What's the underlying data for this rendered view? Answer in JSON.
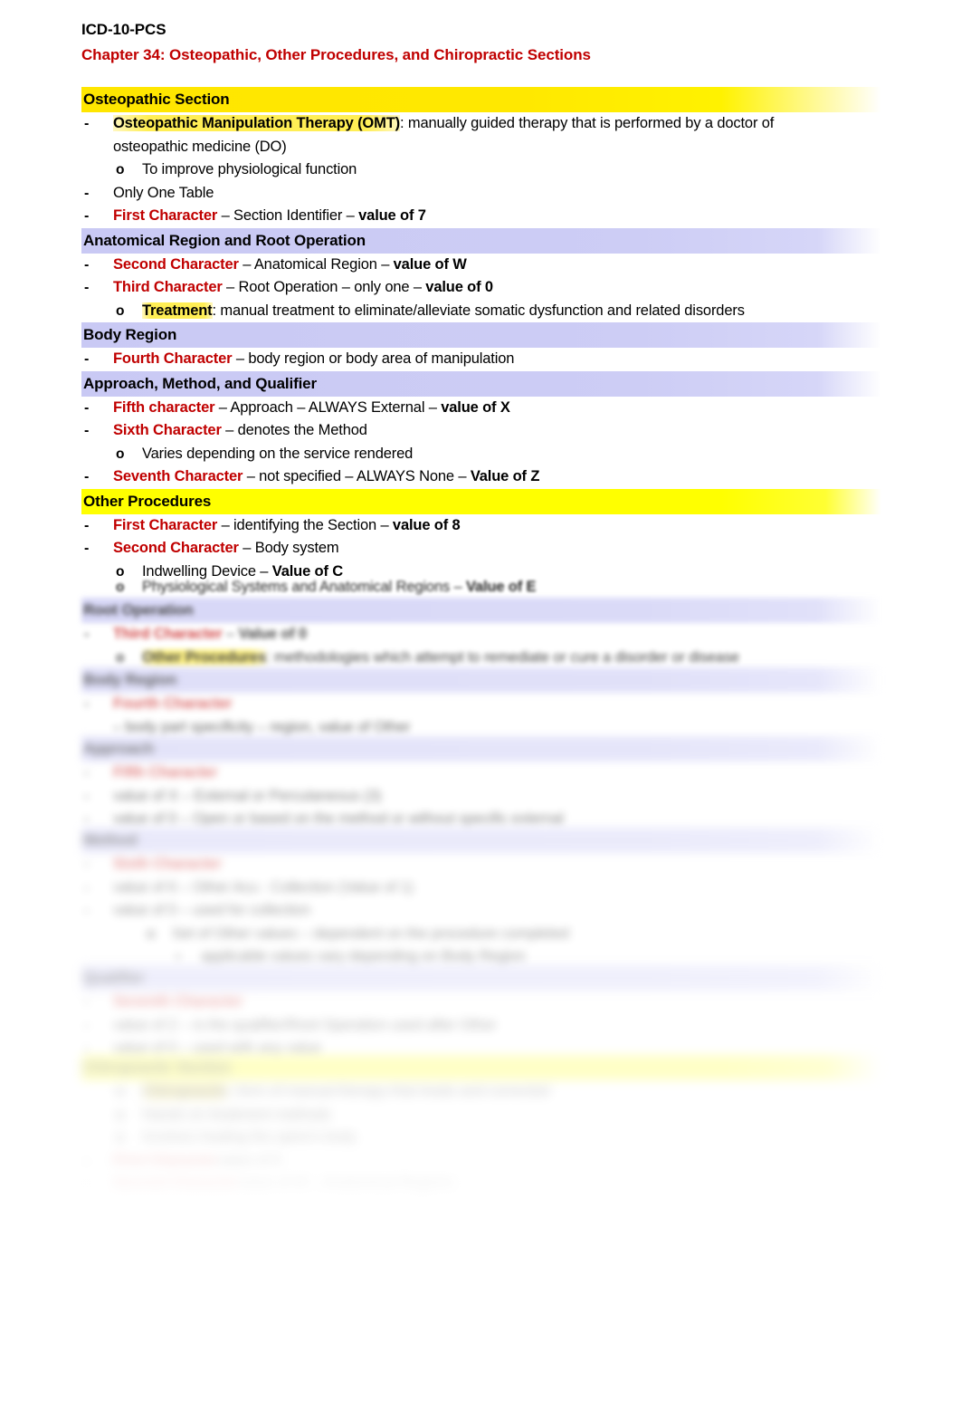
{
  "document": {
    "title": "ICD-10-PCS",
    "chapter": "Chapter 34: Osteopathic, Other Procedures, and Chiropractic Sections"
  },
  "osteopathic": {
    "heading": "Osteopathic Section",
    "omt_term": "Osteopathic Manipulation Therapy (OMT)",
    "omt_def": ": manually guided therapy that is performed by a doctor of",
    "omt_def_line2": "osteopathic medicine (DO)",
    "omt_sub": "To improve physiological function",
    "only_one_table": "Only One Table",
    "first_char_label": "First Character",
    "first_char_rest": " – Section Identifier – ",
    "first_char_value": "value of 7"
  },
  "anatomical": {
    "heading": "Anatomical Region and Root Operation",
    "second_char_label": "Second Character",
    "second_char_rest": " – Anatomical Region – ",
    "second_char_value": "value of W",
    "third_char_label": "Third Character",
    "third_char_rest": " – Root Operation – only one – ",
    "third_char_value": "value of 0",
    "treatment_term": "Treatment",
    "treatment_def": ": manual treatment to eliminate/alleviate somatic dysfunction and related disorders"
  },
  "body_region": {
    "heading": "Body Region",
    "fourth_char_label": "Fourth Character",
    "fourth_char_rest": " – body region or body area of manipulation"
  },
  "approach": {
    "heading": "Approach, Method, and Qualifier",
    "fifth_char_label": "Fifth character",
    "fifth_char_rest": " – Approach – ALWAYS External – ",
    "fifth_char_value": "value of X",
    "sixth_char_label": "Sixth Character",
    "sixth_char_rest": " – denotes the Method",
    "sixth_char_sub": "Varies depending on the service rendered",
    "seventh_char_label": "Seventh Character",
    "seventh_char_rest": " – not specified – ALWAYS None – ",
    "seventh_char_value": "Value of Z"
  },
  "other_procedures": {
    "heading": "Other Procedures",
    "first_char_label": "First Character",
    "first_char_rest": " – identifying the Section – ",
    "first_char_value": "value of 8",
    "second_char_label": "Second Character",
    "second_char_rest": " – Body system",
    "sub_indwelling": "Indwelling Device – ",
    "sub_indwelling_value": "Value of C",
    "sub_physiological": "Physiological Systems and Anatomical Regions – ",
    "sub_physiological_value": "Value of E"
  },
  "obscured": {
    "root_operation": {
      "heading": "Root Operation",
      "third_char_label": "Third Character",
      "third_char_rest": " – ",
      "third_char_value": "Value of 0",
      "other_term": "Other Procedures",
      "other_def": ": methodologies which attempt to remediate or cure a disorder or disease"
    },
    "body_region": {
      "heading": "Body Region",
      "fourth_char_label": "Fourth Character",
      "fourth_char_rest": " – body part specificity – region, value of Other"
    },
    "approach": {
      "heading": "Approach",
      "fifth_char_label": "Fifth Character",
      "rows": [
        "value of X – External or Percutaneous (3)",
        "value of 0 – Open or based on the method or without specific external"
      ]
    },
    "method": {
      "heading": "Method",
      "sixth_char_label": "Sixth Character",
      "rows": [
        "value of 6 – Other Acu - Collection (Value of 1)",
        "value of 0 – used for collection"
      ],
      "sub_rows": [
        "Set of Other values – dependent on the procedure completed",
        "applicable values vary depending on Body Region"
      ]
    },
    "qualifier": {
      "heading": "Qualifier",
      "seventh_char_label": "Seventh Character",
      "rows": [
        "value of Z – is the qualifier/Root Operation used after Other",
        "value of 0 – used with any value"
      ]
    },
    "chiropractic": {
      "heading": "Chiropractic Section",
      "term": "Chiropractic",
      "def": ": form of manual therapy that treats and corrected",
      "rows": [
        "Hands on treatment methods",
        "Involves healing the spine's body",
        "First Character",
        "value of 9",
        "Second Character",
        "value of W  – Anatomical Regions"
      ]
    }
  },
  "colors": {
    "red_heading": "#C00000",
    "blue_band": "#CCCCF5",
    "yellow_highlight": "#FFFF00",
    "text": "#000000"
  }
}
